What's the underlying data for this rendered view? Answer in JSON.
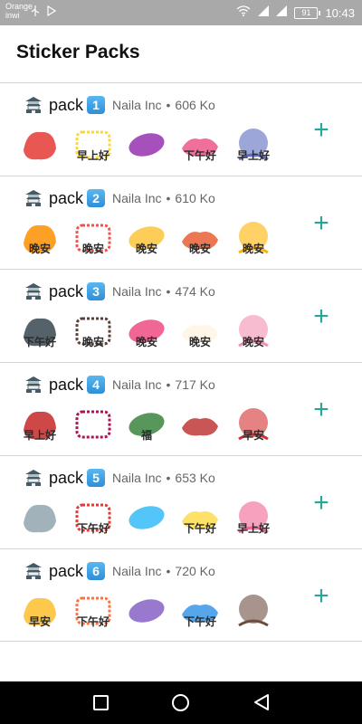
{
  "status_bar": {
    "carrier_line1": "Orange",
    "carrier_line2": "inwi",
    "battery": "91",
    "time": "10:43"
  },
  "title": "Sticker Packs",
  "colors": {
    "accent": "#26a69a",
    "status_bar": "#a9a9a9",
    "keycap": "#2d8fd8"
  },
  "add_label": "+",
  "packs": [
    {
      "name": "pack",
      "number": "1",
      "publisher": "Naila Inc",
      "separator": "•",
      "size": "606 Ko",
      "stickers": [
        {
          "caption": ""
        },
        {
          "caption": "早上好"
        },
        {
          "caption": ""
        },
        {
          "caption": "下午好"
        },
        {
          "caption": "早上好"
        }
      ]
    },
    {
      "name": "pack",
      "number": "2",
      "publisher": "Naila Inc",
      "separator": "•",
      "size": "610 Ko",
      "stickers": [
        {
          "caption": "晚安"
        },
        {
          "caption": "晚安"
        },
        {
          "caption": "晚安"
        },
        {
          "caption": "晚安"
        },
        {
          "caption": "晚安"
        }
      ]
    },
    {
      "name": "pack",
      "number": "3",
      "publisher": "Naila Inc",
      "separator": "•",
      "size": "474 Ko",
      "stickers": [
        {
          "caption": "下午好"
        },
        {
          "caption": "晚安"
        },
        {
          "caption": "晚安"
        },
        {
          "caption": "晚安"
        },
        {
          "caption": "晚安"
        }
      ]
    },
    {
      "name": "pack",
      "number": "4",
      "publisher": "Naila Inc",
      "separator": "•",
      "size": "717 Ko",
      "stickers": [
        {
          "caption": "早上好"
        },
        {
          "caption": ""
        },
        {
          "caption": "福"
        },
        {
          "caption": ""
        },
        {
          "caption": "早安"
        }
      ]
    },
    {
      "name": "pack",
      "number": "5",
      "publisher": "Naila Inc",
      "separator": "•",
      "size": "653 Ko",
      "stickers": [
        {
          "caption": ""
        },
        {
          "caption": "下午好"
        },
        {
          "caption": ""
        },
        {
          "caption": "下午好"
        },
        {
          "caption": "早上好"
        }
      ]
    },
    {
      "name": "pack",
      "number": "6",
      "publisher": "Naila Inc",
      "separator": "•",
      "size": "720 Ko",
      "stickers": [
        {
          "caption": "早安"
        },
        {
          "caption": "下午好"
        },
        {
          "caption": ""
        },
        {
          "caption": "下午好"
        },
        {
          "caption": ""
        }
      ]
    }
  ]
}
